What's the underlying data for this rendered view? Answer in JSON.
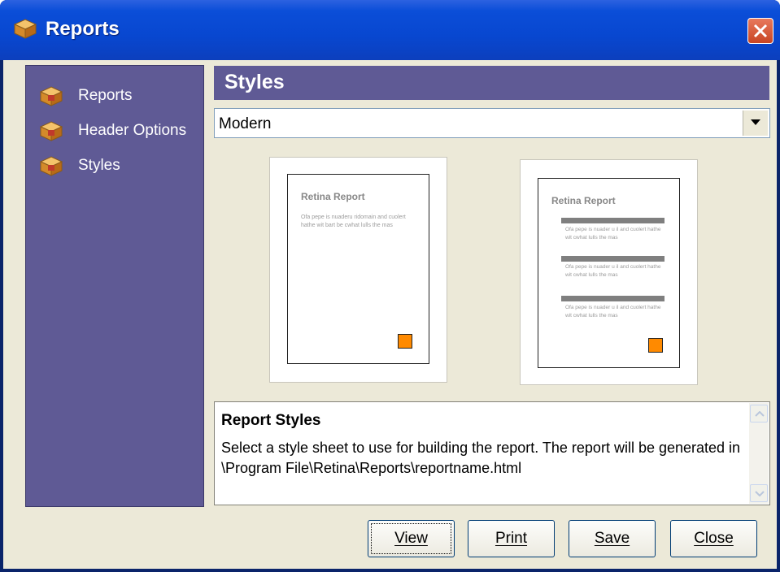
{
  "window": {
    "title": "Reports"
  },
  "sidebar": {
    "items": [
      {
        "label": "Reports",
        "icon": "package-icon"
      },
      {
        "label": "Header Options",
        "icon": "package-icon"
      },
      {
        "label": "Styles",
        "icon": "package-icon"
      }
    ]
  },
  "main": {
    "section_title": "Styles",
    "style_select": {
      "value": "Modern"
    },
    "previews": [
      {
        "title": "Retina Report",
        "text": "Ofa pepe is nuaderu ridomain and cuolert hathe wit bart be cwhat lulls the mas"
      },
      {
        "title": "Retina Report",
        "paragraphs": [
          "Ofa pepe is nuader u il and cuolert hathe wit cwhat lulls the mas",
          "Ofa pepe is nuader u il and cuolert hathe wit cwhat lulls the mas",
          "Ofa pepe is nuader u il and cuolert hathe wit cwhat lulls the mas"
        ]
      }
    ],
    "info": {
      "heading": "Report Styles",
      "body": "Select a style sheet to use for building the report. The report will be generated in \\Program File\\Retina\\Reports\\reportname.html"
    }
  },
  "buttons": {
    "view": "View",
    "print": "Print",
    "save": "Save",
    "close": "Close"
  },
  "colors": {
    "titlebar": "#0847d0",
    "panel": "#5f5a95",
    "accent_orange": "#ff8a00"
  }
}
